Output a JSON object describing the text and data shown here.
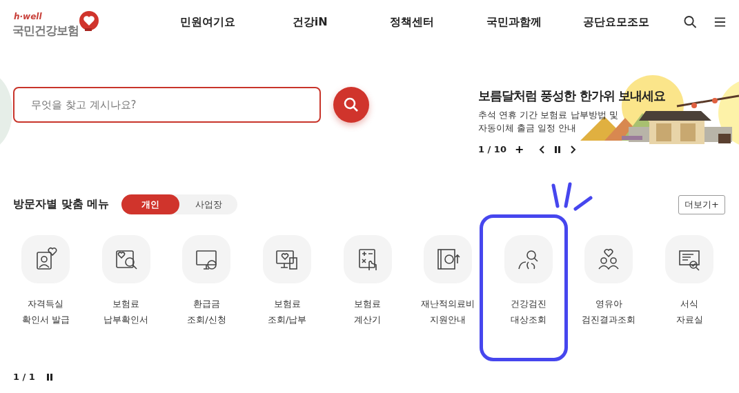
{
  "logo": {
    "tagline": "h·well",
    "name": "국민건강보험"
  },
  "nav": [
    "민원여기요",
    "건강iN",
    "정책센터",
    "국민과함께",
    "공단요모조모"
  ],
  "search": {
    "placeholder": "무엇을 찾고 계시나요?"
  },
  "banner": {
    "title": "보름달처럼 풍성한 한가위 보내세요",
    "text": "추석 연휴 기간 보험료 납부방법 및 자동이체 출금 일정 안내",
    "pager": "1 / 10",
    "add": "+"
  },
  "menu": {
    "title": "방문자별 맞춤 메뉴",
    "tabs": [
      {
        "label": "개인",
        "selected": true
      },
      {
        "label": "사업장",
        "selected": false
      }
    ],
    "more": "더보기+",
    "items": [
      {
        "lines": [
          "자격득실",
          "확인서 발급"
        ],
        "highlighted": false
      },
      {
        "lines": [
          "보험료",
          "납부확인서"
        ],
        "highlighted": false
      },
      {
        "lines": [
          "환급금",
          "조회/신청"
        ],
        "highlighted": false
      },
      {
        "lines": [
          "보험료",
          "조회/납부"
        ],
        "highlighted": false
      },
      {
        "lines": [
          "보험료",
          "계산기"
        ],
        "highlighted": false
      },
      {
        "lines": [
          "재난적의료비",
          "지원안내"
        ],
        "highlighted": false
      },
      {
        "lines": [
          "건강검진",
          "대상조회"
        ],
        "highlighted": true
      },
      {
        "lines": [
          "영유아",
          "검진결과조회"
        ],
        "highlighted": false
      },
      {
        "lines": [
          "서식",
          "자료실"
        ],
        "highlighted": false
      }
    ],
    "pager": "1 / 1"
  }
}
